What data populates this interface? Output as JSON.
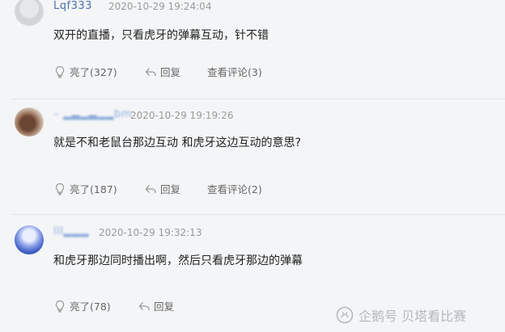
{
  "comments": [
    {
      "username": "Lqf333",
      "time": "2020-10-29 19:24:04",
      "content": "双开的直播，只看虎牙的弹幕互动，针不错",
      "like_label": "亮了(327)",
      "reply_label": "回复",
      "view_replies_label": "查看评论(3)"
    },
    {
      "username": "–",
      "time": "2020-10-29 19:19:26",
      "content": "就是不和老鼠台那边互动 和虎牙这边互动的意思?",
      "like_label": "亮了(187)",
      "reply_label": "回复",
      "view_replies_label": "查看评论(2)"
    },
    {
      "username": "",
      "time": "2020-10-29 19:32:13",
      "content": "和虎牙那边同时播出啊，然后只看虎牙那边的弹幕",
      "like_label": "亮了(78)",
      "reply_label": "回复"
    }
  ],
  "watermark": "企鹅号 贝塔看比赛",
  "icons": {
    "like": "lightbulb-icon",
    "reply": "reply-arrow-icon",
    "watermark": "penguin-logo-icon"
  },
  "colors": {
    "username": "#4d6fa8",
    "timestamp": "#9a9a9a",
    "background": "#f4f5f7"
  }
}
